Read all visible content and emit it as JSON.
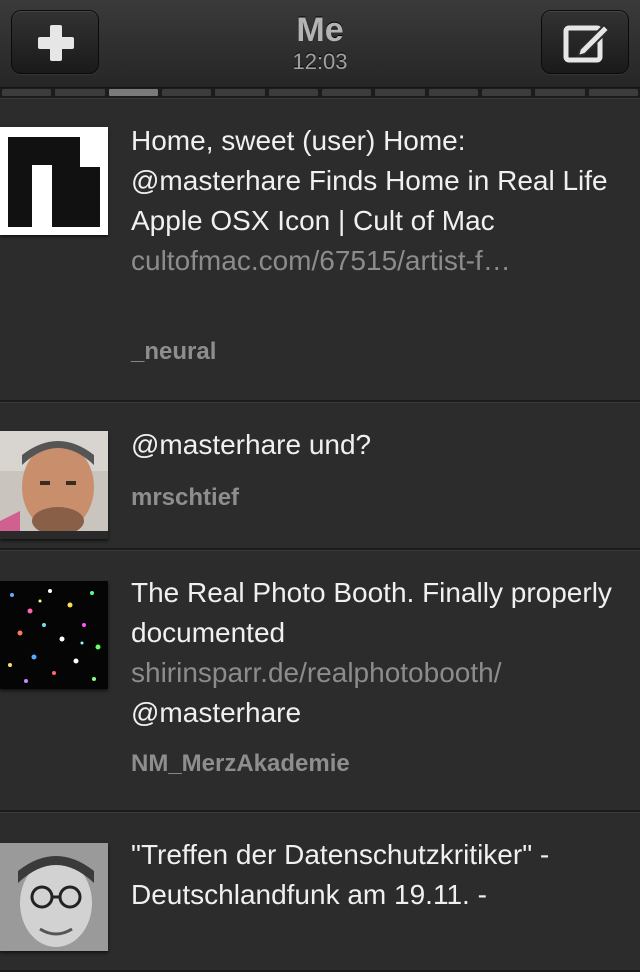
{
  "header": {
    "title": "Me",
    "time": "12:03",
    "left_button_icon": "plus-icon",
    "right_button_icon": "compose-icon"
  },
  "indicator": {
    "pages": 12,
    "active": 2
  },
  "tweets": [
    {
      "avatar_icon": "black-white-logo-avatar",
      "text": "Home, sweet (user) Home: @masterhare Finds Home in Real Life Apple OSX Icon | Cult of Mac ",
      "link": "cultofmac.com/67515/artist-f…",
      "author": "_neural"
    },
    {
      "avatar_icon": "bald-man-avatar",
      "text": "@masterhare und?",
      "link": "",
      "author": "mrschtief"
    },
    {
      "avatar_icon": "starfield-avatar",
      "text": "The Real Photo Booth. Finally properly documented ",
      "link": "shirinsparr.de/realphotobooth/",
      "text_after": " @masterhare",
      "author": "NM_MerzAkademie"
    },
    {
      "avatar_icon": "man-with-glasses-avatar",
      "text": "\"Treffen der Datenschutzkritiker\" - Deutschlandfunk am 19.11. -",
      "link": "",
      "author": ""
    }
  ],
  "colors": {
    "background": "#2c2c2c",
    "text": "#f0f0f0",
    "link": "#8c8c8c",
    "author": "#8e8e8e"
  }
}
